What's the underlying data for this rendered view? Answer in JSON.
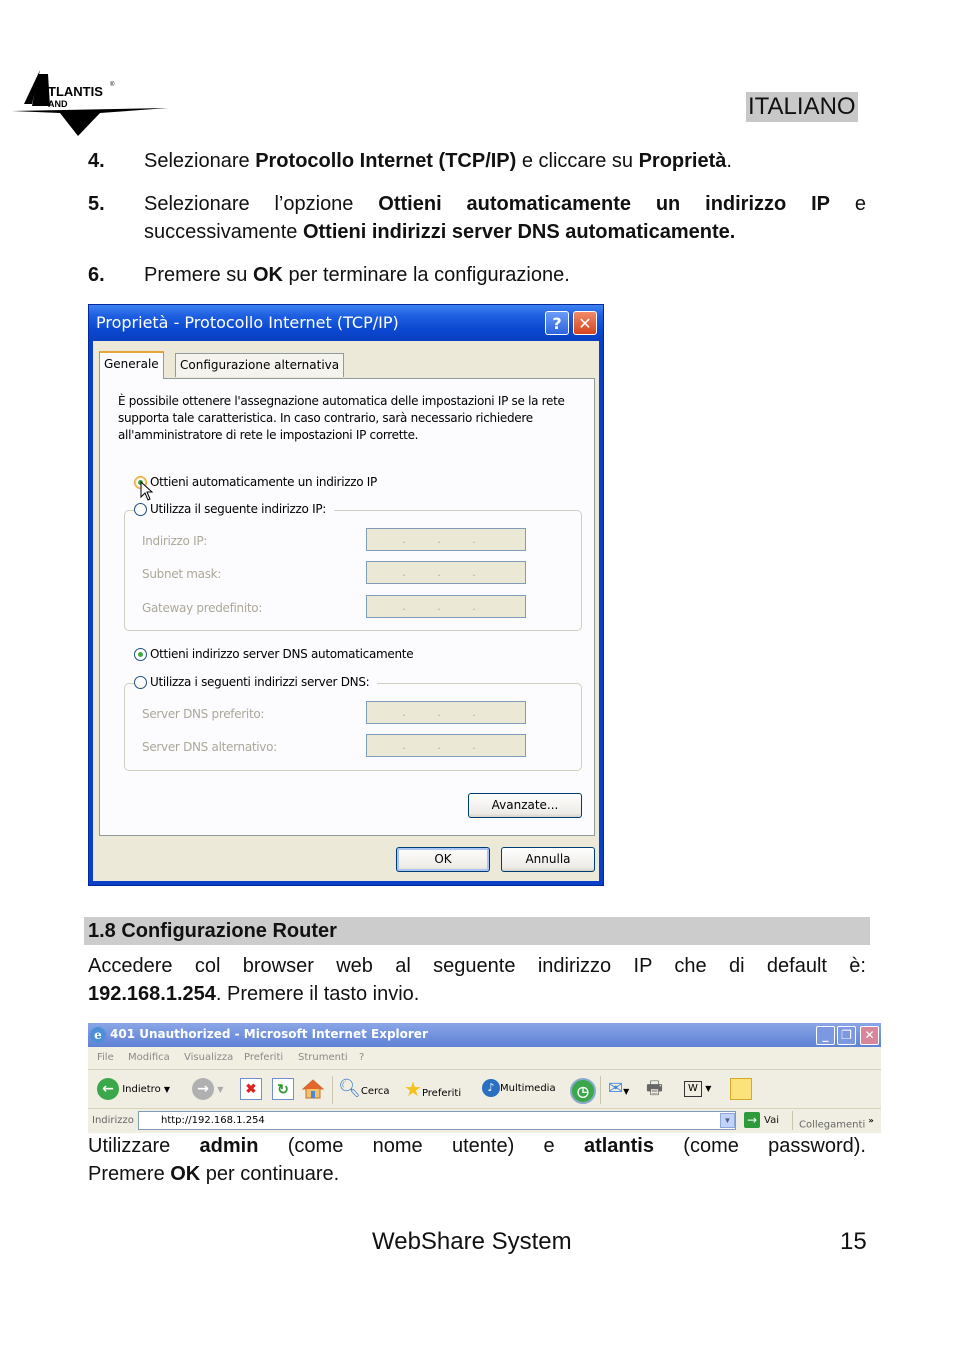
{
  "header": {
    "logo_text": "ATLANTIS LAND",
    "language": "ITALIANO"
  },
  "steps": [
    {
      "num": "4.",
      "parts": [
        {
          "t": "Selezionare ",
          "b": false
        },
        {
          "t": "Protocollo Internet (TCP/IP)",
          "b": true
        },
        {
          "t": " e cliccare su ",
          "b": false
        },
        {
          "t": "Proprietà",
          "b": true
        },
        {
          "t": ".",
          "b": false
        }
      ]
    },
    {
      "num": "5.",
      "parts": [
        {
          "t": "Selezionare l’opzione ",
          "b": false
        },
        {
          "t": "Ottieni automaticamente un indirizzo IP",
          "b": true
        },
        {
          "t": " e successivamente ",
          "b": false
        },
        {
          "t": "Ottieni indirizzi server DNS automaticamente.",
          "b": true
        }
      ]
    },
    {
      "num": "6.",
      "parts": [
        {
          "t": "Premere su  ",
          "b": false
        },
        {
          "t": "OK",
          "b": true
        },
        {
          "t": " per terminare la configurazione.",
          "b": false
        }
      ]
    }
  ],
  "dialog": {
    "title": "Proprietà - Protocollo Internet (TCP/IP)",
    "help_label": "?",
    "close_label": "✕",
    "tabs": [
      "Generale",
      "Configurazione alternativa"
    ],
    "description": "È possibile ottenere l'assegnazione automatica delle impostazioni IP se la rete supporta tale caratteristica. In caso contrario, sarà necessario richiedere all'amministratore di rete le impostazioni IP corrette.",
    "radio_ip_auto": "Ottieni automaticamente un indirizzo IP",
    "radio_ip_manual": "Utilizza il seguente indirizzo IP:",
    "ip_fields": [
      {
        "label": "Indirizzo IP:",
        "value": "...",
        "disabled": true
      },
      {
        "label": "Subnet mask:",
        "value": "...",
        "disabled": true
      },
      {
        "label": "Gateway predefinito:",
        "value": "...",
        "disabled": true
      }
    ],
    "radio_dns_auto": "Ottieni indirizzo server DNS automaticamente",
    "radio_dns_manual": "Utilizza i seguenti indirizzi server DNS:",
    "dns_fields": [
      {
        "label": "Server DNS preferito:",
        "value": "...",
        "disabled": true
      },
      {
        "label": "Server DNS alternativo:",
        "value": "...",
        "disabled": true
      }
    ],
    "ip_selected": "auto",
    "dns_selected": "auto",
    "advanced_button": "Avanzate...",
    "ok_button": "OK",
    "cancel_button": "Annulla"
  },
  "section": {
    "title": "1.8 Configurazione Router",
    "para1_line1": "Accedere col browser web al seguente indirizzo IP che di default è:",
    "para1_ip": "192.168.1.254",
    "para1_rest": ". Premere il tasto invio."
  },
  "browser": {
    "title": "401 Unauthorized - Microsoft Internet Explorer",
    "menu": [
      "File",
      "Modifica",
      "Visualizza",
      "Preferiti",
      "Strumenti",
      "?"
    ],
    "toolbar": {
      "back": "Indietro",
      "search": "Cerca",
      "favorites": "Preferiti",
      "media": "Multimedia"
    },
    "address_label": "Indirizzo",
    "address_value": "http://192.168.1.254",
    "go_label": "Vai",
    "links_label": "Collegamenti",
    "links_more": "»"
  },
  "para2": {
    "p1": "Utilizzare ",
    "user": "admin",
    "p2": " (come nome utente) e ",
    "pass": "atlantis",
    "p3": " (come password).",
    "p4": "Premere ",
    "ok": "OK",
    "p5": " per continuare."
  },
  "footer": {
    "product": "WebShare System",
    "page": "15"
  }
}
